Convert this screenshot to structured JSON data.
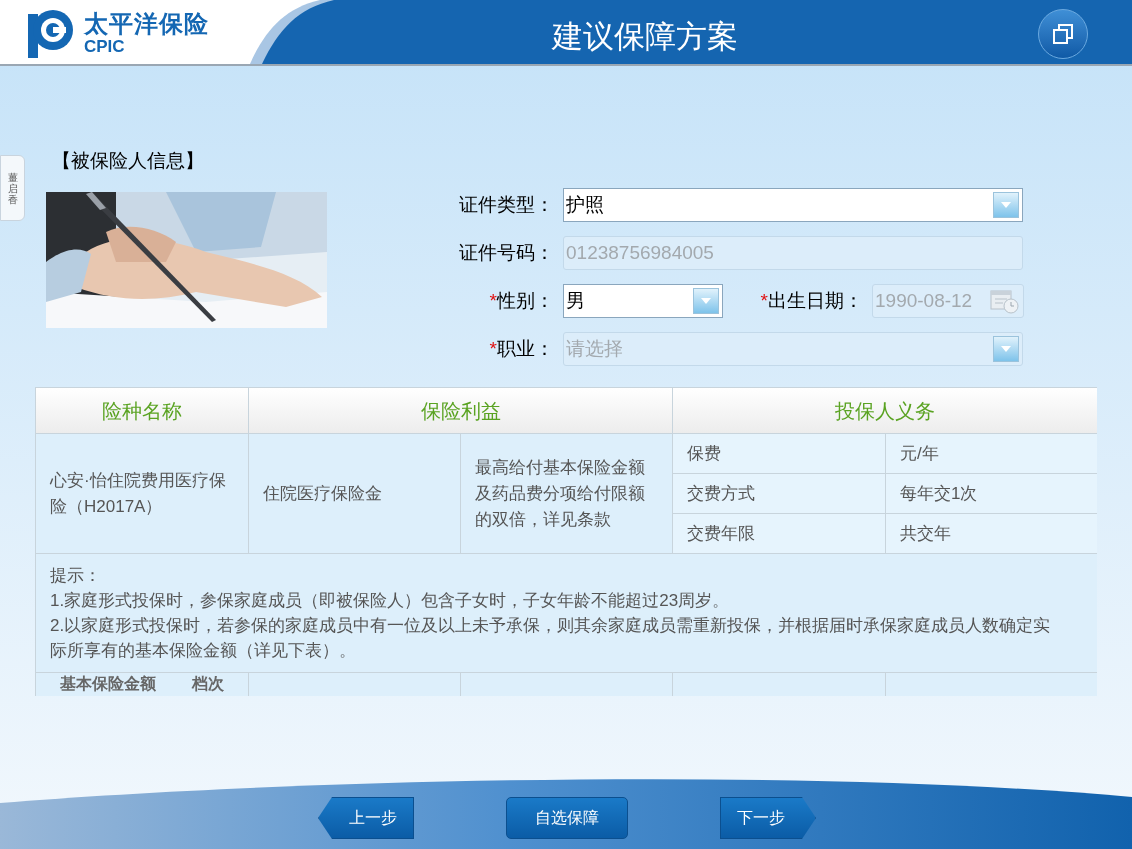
{
  "header": {
    "logo_cn": "太平洋保险",
    "logo_en": "CPIC",
    "title": "建议保障方案"
  },
  "side_tab": {
    "label": "薑启香"
  },
  "section_title": "【被保险人信息】",
  "form": {
    "rows": [
      [
        {
          "kind": "select",
          "label": "证件类型：",
          "value": "护照",
          "disabled": false
        }
      ],
      [
        {
          "kind": "text",
          "label": "证件号码：",
          "value": "01238756984005",
          "disabled": true
        }
      ],
      [
        {
          "kind": "select",
          "label": "性别：",
          "mark": "*",
          "value": "男",
          "disabled": false
        },
        {
          "kind": "date",
          "label": "出生日期：",
          "mark": "*",
          "value": "1990-08-12",
          "disabled": true
        }
      ],
      [
        {
          "kind": "select",
          "label": "职业：",
          "mark": "*",
          "placeholder": "请选择",
          "disabled": true
        }
      ]
    ]
  },
  "table": {
    "columns": [
      "险种名称",
      "保险利益",
      "投保人义务"
    ],
    "product": "心安·怡住院费用医疗保险（H2017A）",
    "benefit": "住院医疗保险金",
    "benefit_detail": "最高给付基本保险金额及药品费分项给付限额的双倍，详见条款",
    "obligations": [
      {
        "name": "保费",
        "value": "元/年"
      },
      {
        "name": "交费方式",
        "value": "每年交1次"
      },
      {
        "name": "交费年限",
        "value": "共交年"
      }
    ],
    "tips": [
      "提示：",
      "1.家庭形式投保时，参保家庭成员（即被保险人）包含子女时，子女年龄不能超过23周岁。",
      "2.以家庭形式投保时，若参保的家庭成员中有一位及以上未予承保，则其余家庭成员需重新投保，并根据届时承保家庭成员人数确定实际所享有的基本保险金额（详见下表）。"
    ],
    "sub_header": {
      "left": "基本保险金额",
      "right": "档次"
    }
  },
  "buttons": [
    {
      "kind": "prev",
      "label": "上一步"
    },
    {
      "kind": "plain",
      "label": "自选保障"
    },
    {
      "kind": "next",
      "label": "下一步"
    }
  ]
}
